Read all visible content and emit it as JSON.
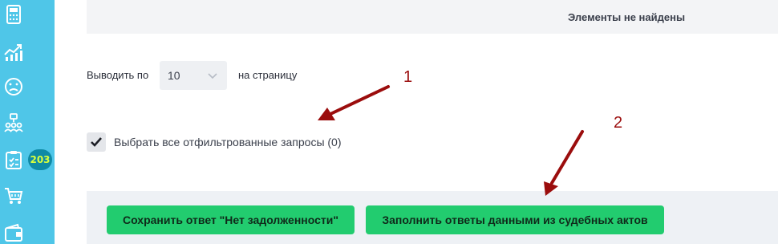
{
  "sidebar": {
    "icons": [
      "calculator-icon",
      "growth-chart-icon",
      "sad-face-icon",
      "team-icon",
      "task-checklist-icon",
      "cart-icon",
      "wallet-icon"
    ],
    "badge": "203",
    "color": "#4fc6e8"
  },
  "results": {
    "empty_message": "Элементы не найдены"
  },
  "pagination": {
    "label": "Выводить по",
    "selected": "10",
    "suffix": "на страницу"
  },
  "selection": {
    "select_all_label": "Выбрать все отфильтрованные запросы (0)",
    "checked": true
  },
  "actions": {
    "save_no_debt": "Сохранить ответ \"Нет задолженности\"",
    "fill_from_court": "Заполнить ответы данными из судебных актов",
    "button_color": "#22cc6f"
  },
  "annotations": {
    "marker_1": "1",
    "marker_2": "2",
    "color": "#9b0d0d"
  }
}
